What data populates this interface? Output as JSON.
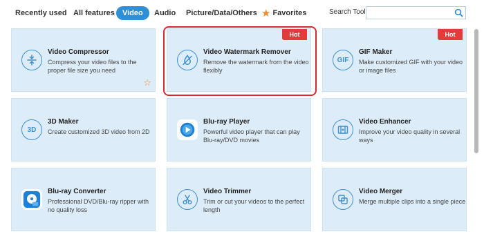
{
  "tabs": [
    {
      "label": "Recently used"
    },
    {
      "label": "All features"
    },
    {
      "label": "Video"
    },
    {
      "label": "Audio"
    },
    {
      "label": "Picture/Data/Others"
    },
    {
      "label": "Favorites"
    }
  ],
  "active_tab": "Video",
  "search": {
    "label": "Search Tool:",
    "value": "",
    "placeholder": ""
  },
  "cards": [
    {
      "title": "Video Compressor",
      "desc": "Compress your video files to the proper file size you need",
      "icon": "compress-icon",
      "badge": "",
      "favorite": true
    },
    {
      "title": "Video Watermark Remover",
      "desc": "Remove the watermark from the video flexibly",
      "icon": "watermark-drop-icon",
      "badge": "Hot",
      "selected": true
    },
    {
      "title": "GIF Maker",
      "desc": "Make customized GIF with your video or image files",
      "icon": "gif-icon",
      "icon_text": "GIF",
      "badge": "Hot"
    },
    {
      "title": "3D Maker",
      "desc": "Create customized 3D video from 2D",
      "icon": "3d-icon",
      "icon_text": "3D",
      "badge": ""
    },
    {
      "title": "Blu-ray Player",
      "desc": "Powerful video player that can play Blu-ray/DVD movies",
      "icon": "bluray-player-icon",
      "badge": ""
    },
    {
      "title": "Video Enhancer",
      "desc": "Improve your video quality in several ways",
      "icon": "enhancer-icon",
      "badge": ""
    },
    {
      "title": "Blu-ray Converter",
      "desc": "Professional DVD/Blu-ray ripper with no quality loss",
      "icon": "bluray-converter-icon",
      "badge": ""
    },
    {
      "title": "Video Trimmer",
      "desc": "Trim or cut your videos to the perfect length",
      "icon": "scissors-icon",
      "badge": ""
    },
    {
      "title": "Video Merger",
      "desc": "Merge multiple clips into a single piece",
      "icon": "merge-icon",
      "badge": ""
    }
  ],
  "colors": {
    "accent": "#2e8fd6",
    "card_bg": "#dcedf9",
    "hot": "#e53a3a",
    "selection": "#d8292d",
    "star": "#f0892f"
  }
}
